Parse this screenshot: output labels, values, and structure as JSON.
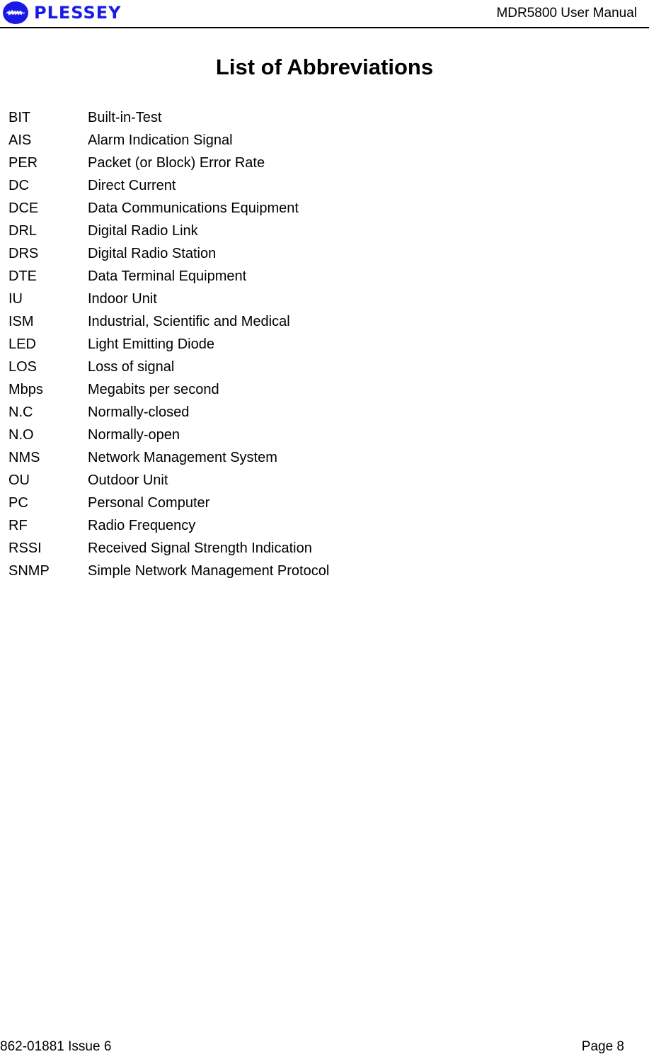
{
  "header": {
    "logo_text": "PLESSEY",
    "logo_icon": "waveform-globe-icon",
    "document_title": "MDR5800 User Manual"
  },
  "page_title": "List of Abbreviations",
  "abbreviations": [
    {
      "term": "BIT",
      "definition": "Built-in-Test"
    },
    {
      "term": "AIS",
      "definition": "Alarm Indication Signal"
    },
    {
      "term": "PER",
      "definition": "Packet (or Block) Error Rate"
    },
    {
      "term": "DC",
      "definition": "Direct Current"
    },
    {
      "term": "DCE",
      "definition": "Data Communications Equipment"
    },
    {
      "term": "DRL",
      "definition": "Digital Radio Link"
    },
    {
      "term": "DRS",
      "definition": "Digital Radio Station"
    },
    {
      "term": "DTE",
      "definition": "Data Terminal Equipment"
    },
    {
      "term": "IU",
      "definition": "Indoor Unit"
    },
    {
      "term": "ISM",
      "definition": "Industrial, Scientific and Medical"
    },
    {
      "term": "LED",
      "definition": "Light Emitting Diode"
    },
    {
      "term": "LOS",
      "definition": "Loss of signal"
    },
    {
      "term": "Mbps",
      "definition": "Megabits per second"
    },
    {
      "term": "N.C",
      "definition": "Normally-closed"
    },
    {
      "term": "N.O",
      "definition": "Normally-open"
    },
    {
      "term": "NMS",
      "definition": "Network Management System"
    },
    {
      "term": "OU",
      "definition": "Outdoor Unit"
    },
    {
      "term": "PC",
      "definition": "Personal Computer"
    },
    {
      "term": "RF",
      "definition": "Radio Frequency"
    },
    {
      "term": "RSSI",
      "definition": "Received Signal Strength Indication"
    },
    {
      "term": "SNMP",
      "definition": "Simple Network Management Protocol"
    }
  ],
  "footer": {
    "document_number": "862-01881 Issue 6",
    "page_label": "Page 8"
  },
  "colors": {
    "brand_blue": "#1a1ae6"
  }
}
